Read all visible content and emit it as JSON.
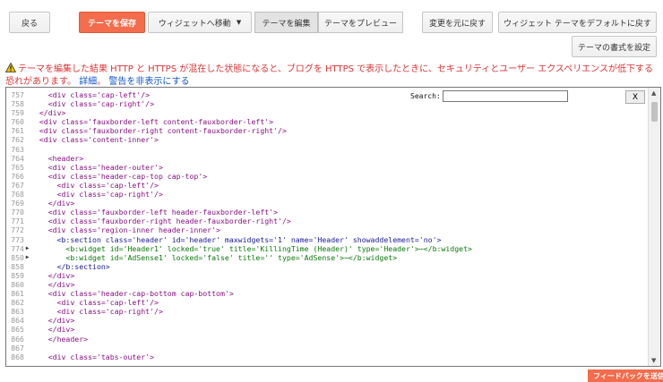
{
  "toolbar": {
    "back": "戻る",
    "save": "テーマを保存",
    "jump_widget": "ウィジェットへ移動",
    "edit_theme": "テーマを編集",
    "preview_theme": "テーマをプレビュー",
    "revert": "変更を元に戻す",
    "reset_widgets": "ウィジェット テーマをデフォルトに戻す",
    "format": "テーマの書式を設定"
  },
  "warning": {
    "text": "テーマを編集した結果 HTTP と HTTPS が混在した状態になると、ブログを HTTPS で表示したときに、セキュリティとユーザー エクスペリエンスが低下する恐れがあります。",
    "details": "詳細",
    "separator": "。",
    "hide": "警告を非表示にする",
    "color": "#dd3333"
  },
  "search": {
    "label": "Search:",
    "value": "",
    "close": "X"
  },
  "code_lines": [
    {
      "n": "757",
      "fold": "",
      "text": "    <div class='cap-left'/>",
      "cls": ""
    },
    {
      "n": "758",
      "fold": "",
      "text": "    <div class='cap-right'/>",
      "cls": ""
    },
    {
      "n": "759",
      "fold": "",
      "text": "  </div>",
      "cls": ""
    },
    {
      "n": "760",
      "fold": "",
      "text": "  <div class='fauxborder-left content-fauxborder-left'>",
      "cls": ""
    },
    {
      "n": "761",
      "fold": "",
      "text": "  <div class='fauxborder-right content-fauxborder-right'/>",
      "cls": ""
    },
    {
      "n": "762",
      "fold": "",
      "text": "  <div class='content-inner'>",
      "cls": ""
    },
    {
      "n": "763",
      "fold": "",
      "text": "",
      "cls": ""
    },
    {
      "n": "764",
      "fold": "",
      "text": "    <header>",
      "cls": ""
    },
    {
      "n": "765",
      "fold": "",
      "text": "    <div class='header-outer'>",
      "cls": ""
    },
    {
      "n": "766",
      "fold": "",
      "text": "    <div class='header-cap-top cap-top'>",
      "cls": ""
    },
    {
      "n": "767",
      "fold": "",
      "text": "      <div class='cap-left'/>",
      "cls": ""
    },
    {
      "n": "768",
      "fold": "",
      "text": "      <div class='cap-right'/>",
      "cls": ""
    },
    {
      "n": "769",
      "fold": "",
      "text": "    </div>",
      "cls": ""
    },
    {
      "n": "770",
      "fold": "",
      "text": "    <div class='fauxborder-left header-fauxborder-left'>",
      "cls": ""
    },
    {
      "n": "771",
      "fold": "",
      "text": "    <div class='fauxborder-right header-fauxborder-right'/>",
      "cls": ""
    },
    {
      "n": "772",
      "fold": "",
      "text": "    <div class='region-inner header-inner'>",
      "cls": ""
    },
    {
      "n": "773",
      "fold": "",
      "text": "      <b:section class='header' id='header' maxwidgets='1' name='Header' showaddelement='no'>",
      "cls": "w"
    },
    {
      "n": "774",
      "fold": "▶",
      "text": "        <b:widget id='Header1' locked='true' title='KillingTime (Header)' type='Header'>⋯</b:widget>",
      "cls": "g"
    },
    {
      "n": "850",
      "fold": "▶",
      "text": "        <b:widget id='AdSense1' locked='false' title='' type='AdSense'>⋯</b:widget>",
      "cls": "g"
    },
    {
      "n": "858",
      "fold": "",
      "text": "      </b:section>",
      "cls": "w"
    },
    {
      "n": "859",
      "fold": "",
      "text": "    </div>",
      "cls": ""
    },
    {
      "n": "860",
      "fold": "",
      "text": "    </div>",
      "cls": ""
    },
    {
      "n": "861",
      "fold": "",
      "text": "    <div class='header-cap-bottom cap-bottom'>",
      "cls": ""
    },
    {
      "n": "862",
      "fold": "",
      "text": "      <div class='cap-left'/>",
      "cls": ""
    },
    {
      "n": "863",
      "fold": "",
      "text": "      <div class='cap-right'/>",
      "cls": ""
    },
    {
      "n": "864",
      "fold": "",
      "text": "    </div>",
      "cls": ""
    },
    {
      "n": "865",
      "fold": "",
      "text": "    </div>",
      "cls": ""
    },
    {
      "n": "866",
      "fold": "",
      "text": "    </header>",
      "cls": ""
    },
    {
      "n": "867",
      "fold": "",
      "text": "",
      "cls": ""
    },
    {
      "n": "868",
      "fold": "",
      "text": "    <div class='tabs-outer'>",
      "cls": ""
    }
  ],
  "feedback": "フィードバックを送信"
}
